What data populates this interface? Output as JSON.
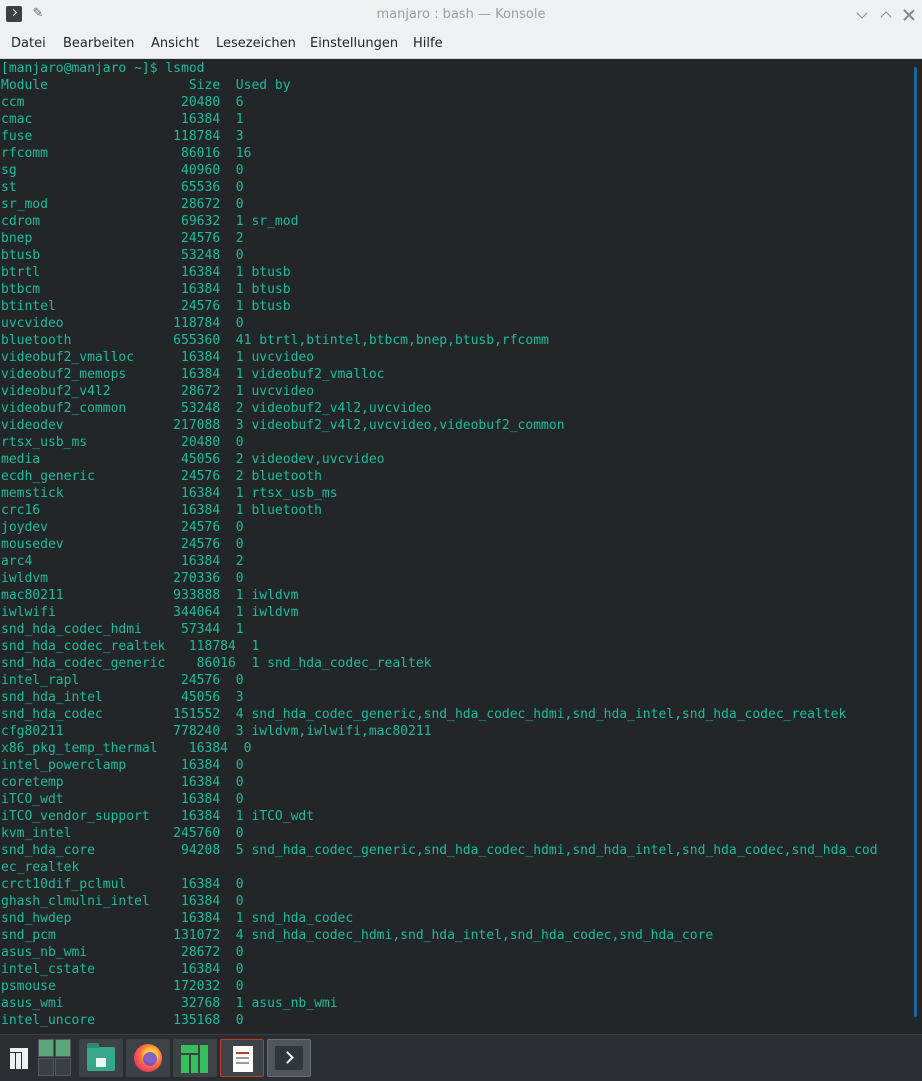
{
  "window": {
    "title": "manjaro : bash — Konsole"
  },
  "menu": [
    "Datei",
    "Bearbeiten",
    "Ansicht",
    "Lesezeichen",
    "Einstellungen",
    "Hilfe"
  ],
  "terminal": {
    "lines": [
      "[manjaro@manjaro ~]$ lsmod",
      "Module                  Size  Used by",
      "ccm                    20480  6",
      "cmac                   16384  1",
      "fuse                  118784  3",
      "rfcomm                 86016  16",
      "sg                     40960  0",
      "st                     65536  0",
      "sr_mod                 28672  0",
      "cdrom                  69632  1 sr_mod",
      "bnep                   24576  2",
      "btusb                  53248  0",
      "btrtl                  16384  1 btusb",
      "btbcm                  16384  1 btusb",
      "btintel                24576  1 btusb",
      "uvcvideo              118784  0",
      "bluetooth             655360  41 btrtl,btintel,btbcm,bnep,btusb,rfcomm",
      "videobuf2_vmalloc      16384  1 uvcvideo",
      "videobuf2_memops       16384  1 videobuf2_vmalloc",
      "videobuf2_v4l2         28672  1 uvcvideo",
      "videobuf2_common       53248  2 videobuf2_v4l2,uvcvideo",
      "videodev              217088  3 videobuf2_v4l2,uvcvideo,videobuf2_common",
      "rtsx_usb_ms            20480  0",
      "media                  45056  2 videodev,uvcvideo",
      "ecdh_generic           24576  2 bluetooth",
      "memstick               16384  1 rtsx_usb_ms",
      "crc16                  16384  1 bluetooth",
      "joydev                 24576  0",
      "mousedev               24576  0",
      "arc4                   16384  2",
      "iwldvm                270336  0",
      "mac80211              933888  1 iwldvm",
      "iwlwifi               344064  1 iwldvm",
      "snd_hda_codec_hdmi     57344  1",
      "snd_hda_codec_realtek   118784  1",
      "snd_hda_codec_generic    86016  1 snd_hda_codec_realtek",
      "intel_rapl             24576  0",
      "snd_hda_intel          45056  3",
      "snd_hda_codec         151552  4 snd_hda_codec_generic,snd_hda_codec_hdmi,snd_hda_intel,snd_hda_codec_realtek",
      "cfg80211              778240  3 iwldvm,iwlwifi,mac80211",
      "x86_pkg_temp_thermal    16384  0",
      "intel_powerclamp       16384  0",
      "coretemp               16384  0",
      "iTCO_wdt               16384  0",
      "iTCO_vendor_support    16384  1 iTCO_wdt",
      "kvm_intel             245760  0",
      "snd_hda_core           94208  5 snd_hda_codec_generic,snd_hda_codec_hdmi,snd_hda_intel,snd_hda_codec,snd_hda_cod",
      "ec_realtek",
      "crct10dif_pclmul       16384  0",
      "ghash_clmulni_intel    16384  0",
      "snd_hwdep              16384  1 snd_hda_codec",
      "snd_pcm               131072  4 snd_hda_codec_hdmi,snd_hda_intel,snd_hda_codec,snd_hda_core",
      "asus_nb_wmi            28672  0",
      "intel_cstate           16384  0",
      "psmouse               172032  0",
      "asus_wmi               32768  1 asus_nb_wmi",
      "intel_uncore          135168  0"
    ]
  },
  "taskbar": {
    "items": [
      "application-launcher-icon",
      "pager-icon",
      "file-manager-icon",
      "firefox-icon",
      "manjaro-settings-icon",
      "text-editor-icon",
      "konsole-icon"
    ]
  },
  "colors": {
    "terminal_bg": "#232629",
    "terminal_fg": "#1abc9c",
    "chrome_bg": "#eff0f1",
    "taskbar_bg": "#2a2e32"
  }
}
